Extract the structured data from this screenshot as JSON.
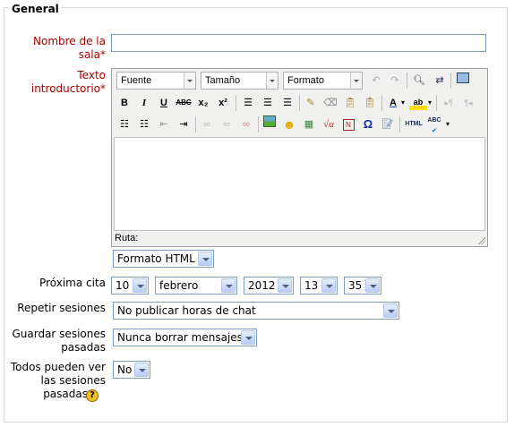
{
  "form": {
    "legend": "General",
    "name_label_line1": "Nombre de la",
    "name_label_line2": "sala",
    "intro_label_line1": "Texto",
    "intro_label_line2": "introductorio",
    "required_mark": "*",
    "name_value": ""
  },
  "editor": {
    "font_select": "Fuente",
    "size_select": "Tamaño",
    "format_select": "Formato",
    "path_label": "Ruta:",
    "btn_bold": "B",
    "btn_italic": "I",
    "btn_underline": "U",
    "btn_strike": "ABC",
    "btn_sub": "x₂",
    "btn_sup": "x²",
    "btn_omega": "Ω",
    "btn_html": "HTML",
    "btn_abc": "ABC"
  },
  "format": {
    "selected": "Formato HTML"
  },
  "next_date": {
    "label": "Próxima cita",
    "day": "10",
    "month": "febrero",
    "year": "2012",
    "hour": "13",
    "minute": "35"
  },
  "repeat": {
    "label": "Repetir sesiones",
    "selected": "No publicar horas de chat"
  },
  "keep": {
    "label_line1": "Guardar sesiones",
    "label_line2": "pasadas",
    "selected": "Nunca borrar mensajes"
  },
  "view": {
    "label_line1": "Todos pueden ver",
    "label_line2": "las sesiones",
    "label_line3": "pasadas",
    "selected": "No",
    "help_glyph": "?"
  },
  "colors": {
    "required": "#aa0000",
    "border": "#7f9db9"
  }
}
